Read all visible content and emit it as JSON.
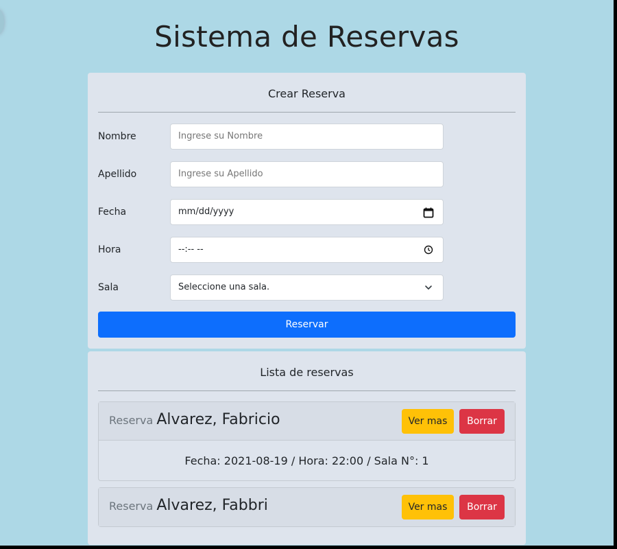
{
  "page": {
    "title": "Sistema de Reservas"
  },
  "create_form": {
    "header": "Crear Reserva",
    "fields": [
      {
        "label": "Nombre",
        "placeholder": "Ingrese su Nombre",
        "type": "text"
      },
      {
        "label": "Apellido",
        "placeholder": "Ingrese su Apellido",
        "type": "text"
      },
      {
        "label": "Fecha",
        "value": "mm/dd/yyyy",
        "type": "date",
        "icon": "calendar-icon"
      },
      {
        "label": "Hora",
        "value": "--:-- --",
        "type": "time",
        "icon": "clock-icon"
      },
      {
        "label": "Sala",
        "value": "Seleccione una sala.",
        "type": "select",
        "icon": "chevron-down-icon"
      }
    ],
    "submit_label": "Reservar"
  },
  "reservations": {
    "header": "Lista de reservas",
    "items": [
      {
        "prefix": "Reserva",
        "name": "Alvarez, Fabricio",
        "view_label": "Ver mas",
        "delete_label": "Borrar",
        "detail": "Fecha: 2021-08-19 / Hora: 22:00 / Sala N°: 1",
        "expanded": true
      },
      {
        "prefix": "Reserva",
        "name": "Alvarez, Fabbri",
        "view_label": "Ver mas",
        "delete_label": "Borrar",
        "expanded": false
      }
    ]
  },
  "colors": {
    "background": "#add8e6",
    "panel": "#dee4ed",
    "primary": "#0d6efd",
    "warning": "#ffc107",
    "danger": "#dc3545"
  }
}
